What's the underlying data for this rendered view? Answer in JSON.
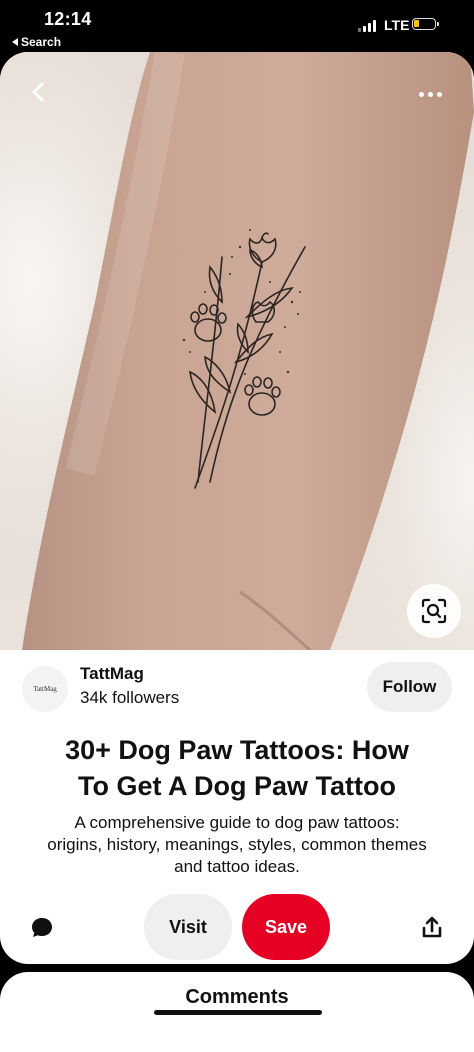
{
  "status_bar": {
    "time": "12:14",
    "back_app": "Search",
    "network": "LTE",
    "battery_color": "#f5c518"
  },
  "pin": {
    "image_icons": {
      "back": "chevron-left-icon",
      "more": "more-horizontal-icon",
      "visual_search": "lens-search-icon"
    },
    "creator": {
      "avatar_text": "TattMag",
      "name": "TattMag",
      "followers": "34k followers",
      "follow_label": "Follow"
    },
    "title_line1": "30+ Dog Paw Tattoos: How",
    "title_line2": "To Get A Dog Paw Tattoo",
    "description_line1": "A comprehensive guide to dog paw tattoos:",
    "description_line2": "origins, history, meanings, styles, common themes",
    "description_line3": "and tattoo ideas.",
    "actions": {
      "comment_icon": "speech-bubble-icon",
      "visit_label": "Visit",
      "save_label": "Save",
      "share_icon": "share-icon",
      "save_color": "#e60023"
    }
  },
  "comments": {
    "title": "Comments"
  }
}
